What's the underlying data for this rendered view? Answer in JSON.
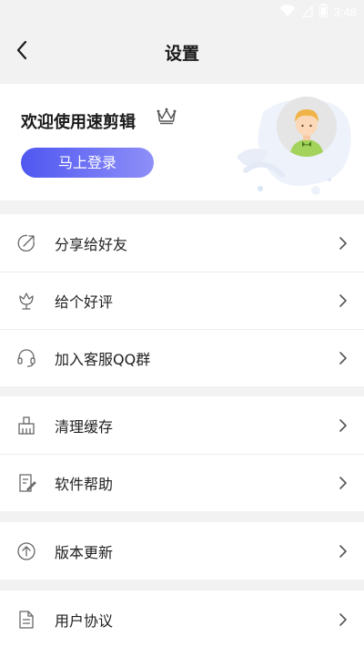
{
  "status_bar": {
    "time": "3:48",
    "icons": [
      "wifi-icon",
      "signal-icon",
      "battery-icon"
    ]
  },
  "header": {
    "title": "设置",
    "back_icon": "chevron-left-icon"
  },
  "profile": {
    "welcome": "欢迎使用速剪辑",
    "badge_icon": "crown-icon",
    "login_label": "马上登录",
    "avatar_icon": "default-avatar-icon"
  },
  "groups": [
    {
      "items": [
        {
          "label": "分享给好友",
          "icon": "share-icon"
        },
        {
          "label": "给个好评",
          "icon": "flower-icon"
        },
        {
          "label": "加入客服QQ群",
          "icon": "headset-icon"
        }
      ]
    },
    {
      "items": [
        {
          "label": "清理缓存",
          "icon": "broom-icon"
        },
        {
          "label": "软件帮助",
          "icon": "help-doc-icon"
        }
      ]
    },
    {
      "items": [
        {
          "label": "版本更新",
          "icon": "upgrade-icon"
        }
      ]
    },
    {
      "items": [
        {
          "label": "用户协议",
          "icon": "document-icon"
        }
      ]
    }
  ],
  "colors": {
    "accent_start": "#4f57f0",
    "accent_end": "#8e8ff8",
    "background": "#f2f2f2",
    "text": "#1f1f1f",
    "icon": "#666666"
  }
}
